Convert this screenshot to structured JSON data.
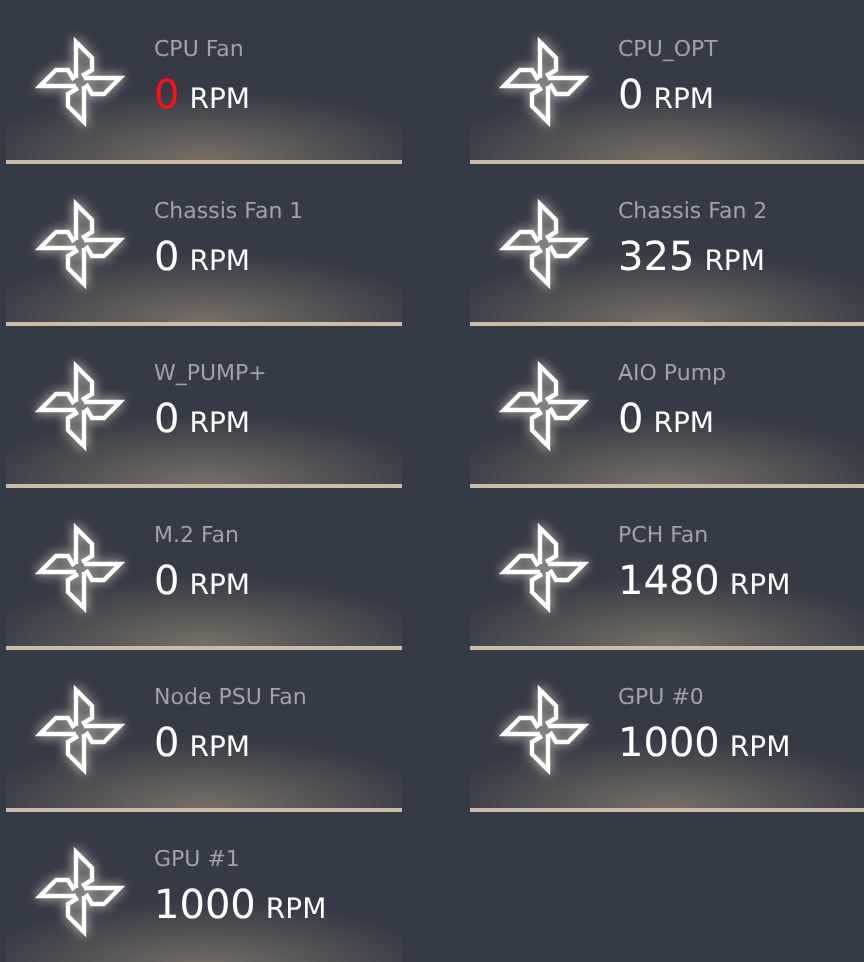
{
  "fans": [
    {
      "name": "CPU Fan",
      "value": "0",
      "unit": "RPM",
      "alert": true
    },
    {
      "name": "CPU_OPT",
      "value": "0",
      "unit": "RPM",
      "alert": false
    },
    {
      "name": "Chassis Fan 1",
      "value": "0",
      "unit": "RPM",
      "alert": false
    },
    {
      "name": "Chassis Fan 2",
      "value": "325",
      "unit": "RPM",
      "alert": false
    },
    {
      "name": "W_PUMP+",
      "value": "0",
      "unit": "RPM",
      "alert": false
    },
    {
      "name": "AIO Pump",
      "value": "0",
      "unit": "RPM",
      "alert": false
    },
    {
      "name": "M.2 Fan",
      "value": "0",
      "unit": "RPM",
      "alert": false
    },
    {
      "name": "PCH Fan",
      "value": "1480",
      "unit": "RPM",
      "alert": false
    },
    {
      "name": "Node PSU Fan",
      "value": "0",
      "unit": "RPM",
      "alert": false
    },
    {
      "name": "GPU #0",
      "value": "1000",
      "unit": "RPM",
      "alert": false
    },
    {
      "name": "GPU #1",
      "value": "1000",
      "unit": "RPM",
      "alert": false
    }
  ]
}
